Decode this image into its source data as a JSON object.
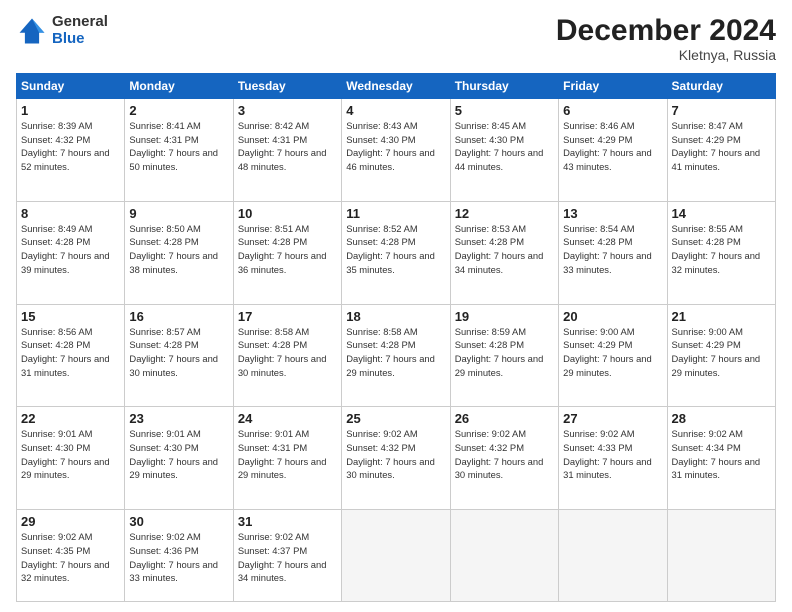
{
  "header": {
    "logo_general": "General",
    "logo_blue": "Blue",
    "month_title": "December 2024",
    "location": "Kletnya, Russia"
  },
  "days_of_week": [
    "Sunday",
    "Monday",
    "Tuesday",
    "Wednesday",
    "Thursday",
    "Friday",
    "Saturday"
  ],
  "weeks": [
    [
      {
        "day": "1",
        "sunrise": "Sunrise: 8:39 AM",
        "sunset": "Sunset: 4:32 PM",
        "daylight": "Daylight: 7 hours and 52 minutes."
      },
      {
        "day": "2",
        "sunrise": "Sunrise: 8:41 AM",
        "sunset": "Sunset: 4:31 PM",
        "daylight": "Daylight: 7 hours and 50 minutes."
      },
      {
        "day": "3",
        "sunrise": "Sunrise: 8:42 AM",
        "sunset": "Sunset: 4:31 PM",
        "daylight": "Daylight: 7 hours and 48 minutes."
      },
      {
        "day": "4",
        "sunrise": "Sunrise: 8:43 AM",
        "sunset": "Sunset: 4:30 PM",
        "daylight": "Daylight: 7 hours and 46 minutes."
      },
      {
        "day": "5",
        "sunrise": "Sunrise: 8:45 AM",
        "sunset": "Sunset: 4:30 PM",
        "daylight": "Daylight: 7 hours and 44 minutes."
      },
      {
        "day": "6",
        "sunrise": "Sunrise: 8:46 AM",
        "sunset": "Sunset: 4:29 PM",
        "daylight": "Daylight: 7 hours and 43 minutes."
      },
      {
        "day": "7",
        "sunrise": "Sunrise: 8:47 AM",
        "sunset": "Sunset: 4:29 PM",
        "daylight": "Daylight: 7 hours and 41 minutes."
      }
    ],
    [
      {
        "day": "8",
        "sunrise": "Sunrise: 8:49 AM",
        "sunset": "Sunset: 4:28 PM",
        "daylight": "Daylight: 7 hours and 39 minutes."
      },
      {
        "day": "9",
        "sunrise": "Sunrise: 8:50 AM",
        "sunset": "Sunset: 4:28 PM",
        "daylight": "Daylight: 7 hours and 38 minutes."
      },
      {
        "day": "10",
        "sunrise": "Sunrise: 8:51 AM",
        "sunset": "Sunset: 4:28 PM",
        "daylight": "Daylight: 7 hours and 36 minutes."
      },
      {
        "day": "11",
        "sunrise": "Sunrise: 8:52 AM",
        "sunset": "Sunset: 4:28 PM",
        "daylight": "Daylight: 7 hours and 35 minutes."
      },
      {
        "day": "12",
        "sunrise": "Sunrise: 8:53 AM",
        "sunset": "Sunset: 4:28 PM",
        "daylight": "Daylight: 7 hours and 34 minutes."
      },
      {
        "day": "13",
        "sunrise": "Sunrise: 8:54 AM",
        "sunset": "Sunset: 4:28 PM",
        "daylight": "Daylight: 7 hours and 33 minutes."
      },
      {
        "day": "14",
        "sunrise": "Sunrise: 8:55 AM",
        "sunset": "Sunset: 4:28 PM",
        "daylight": "Daylight: 7 hours and 32 minutes."
      }
    ],
    [
      {
        "day": "15",
        "sunrise": "Sunrise: 8:56 AM",
        "sunset": "Sunset: 4:28 PM",
        "daylight": "Daylight: 7 hours and 31 minutes."
      },
      {
        "day": "16",
        "sunrise": "Sunrise: 8:57 AM",
        "sunset": "Sunset: 4:28 PM",
        "daylight": "Daylight: 7 hours and 30 minutes."
      },
      {
        "day": "17",
        "sunrise": "Sunrise: 8:58 AM",
        "sunset": "Sunset: 4:28 PM",
        "daylight": "Daylight: 7 hours and 30 minutes."
      },
      {
        "day": "18",
        "sunrise": "Sunrise: 8:58 AM",
        "sunset": "Sunset: 4:28 PM",
        "daylight": "Daylight: 7 hours and 29 minutes."
      },
      {
        "day": "19",
        "sunrise": "Sunrise: 8:59 AM",
        "sunset": "Sunset: 4:28 PM",
        "daylight": "Daylight: 7 hours and 29 minutes."
      },
      {
        "day": "20",
        "sunrise": "Sunrise: 9:00 AM",
        "sunset": "Sunset: 4:29 PM",
        "daylight": "Daylight: 7 hours and 29 minutes."
      },
      {
        "day": "21",
        "sunrise": "Sunrise: 9:00 AM",
        "sunset": "Sunset: 4:29 PM",
        "daylight": "Daylight: 7 hours and 29 minutes."
      }
    ],
    [
      {
        "day": "22",
        "sunrise": "Sunrise: 9:01 AM",
        "sunset": "Sunset: 4:30 PM",
        "daylight": "Daylight: 7 hours and 29 minutes."
      },
      {
        "day": "23",
        "sunrise": "Sunrise: 9:01 AM",
        "sunset": "Sunset: 4:30 PM",
        "daylight": "Daylight: 7 hours and 29 minutes."
      },
      {
        "day": "24",
        "sunrise": "Sunrise: 9:01 AM",
        "sunset": "Sunset: 4:31 PM",
        "daylight": "Daylight: 7 hours and 29 minutes."
      },
      {
        "day": "25",
        "sunrise": "Sunrise: 9:02 AM",
        "sunset": "Sunset: 4:32 PM",
        "daylight": "Daylight: 7 hours and 30 minutes."
      },
      {
        "day": "26",
        "sunrise": "Sunrise: 9:02 AM",
        "sunset": "Sunset: 4:32 PM",
        "daylight": "Daylight: 7 hours and 30 minutes."
      },
      {
        "day": "27",
        "sunrise": "Sunrise: 9:02 AM",
        "sunset": "Sunset: 4:33 PM",
        "daylight": "Daylight: 7 hours and 31 minutes."
      },
      {
        "day": "28",
        "sunrise": "Sunrise: 9:02 AM",
        "sunset": "Sunset: 4:34 PM",
        "daylight": "Daylight: 7 hours and 31 minutes."
      }
    ],
    [
      {
        "day": "29",
        "sunrise": "Sunrise: 9:02 AM",
        "sunset": "Sunset: 4:35 PM",
        "daylight": "Daylight: 7 hours and 32 minutes."
      },
      {
        "day": "30",
        "sunrise": "Sunrise: 9:02 AM",
        "sunset": "Sunset: 4:36 PM",
        "daylight": "Daylight: 7 hours and 33 minutes."
      },
      {
        "day": "31",
        "sunrise": "Sunrise: 9:02 AM",
        "sunset": "Sunset: 4:37 PM",
        "daylight": "Daylight: 7 hours and 34 minutes."
      },
      null,
      null,
      null,
      null
    ]
  ]
}
